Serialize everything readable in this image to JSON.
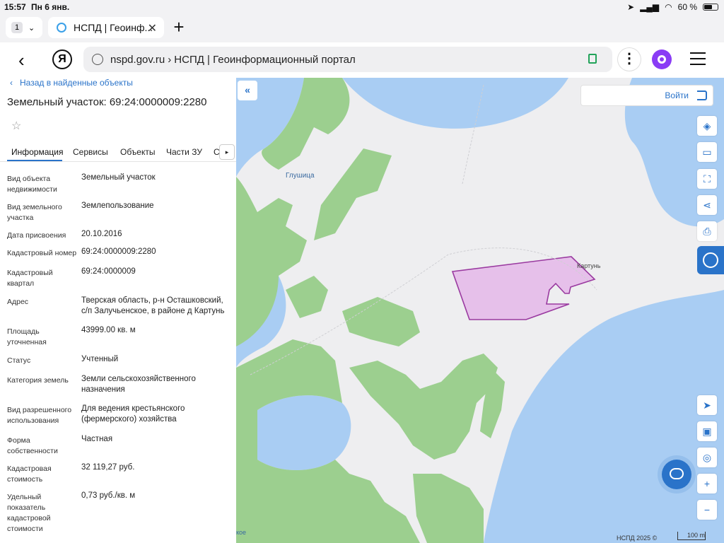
{
  "status_bar": {
    "time": "15:57",
    "date": "Пн 6 янв.",
    "battery": "60 %",
    "battery_level": 0.6
  },
  "browser": {
    "tab_count": "1",
    "tab_title": "НСПД | Геоинф...",
    "url_domain": "nspd.gov.ru",
    "url_separator": "›",
    "page_title": "НСПД | Геоинформационный портал"
  },
  "panel": {
    "back_link": "Назад в найденные объекты",
    "title": "Земельный участок: 69:24:0000009:2280",
    "tabs": [
      "Информация",
      "Сервисы",
      "Объекты",
      "Части ЗУ",
      "С"
    ],
    "rows": [
      {
        "key": "Вид объекта недвижимости",
        "value": "Земельный участок"
      },
      {
        "key": "Вид земельного участка",
        "value": "Землепользование"
      },
      {
        "key": "Дата присвоения",
        "value": "20.10.2016"
      },
      {
        "key": "Кадастровый номер",
        "value": "69:24:0000009:2280"
      },
      {
        "key": "Кадастровый квартал",
        "value": "69:24:0000009"
      },
      {
        "key": "Адрес",
        "value": "Тверская область, р-н Осташковский, с/п Залучьенское, в районе д Картунь"
      },
      {
        "key": "Площадь уточненная",
        "value": "43999.00 кв. м"
      },
      {
        "key": "Статус",
        "value": "Учтенный"
      },
      {
        "key": "Категория земель",
        "value": "Земли сельскохозяйственного назначения"
      },
      {
        "key": "Вид разрешенного использования",
        "value": "Для ведения крестьянского (фермерского) хозяйства"
      },
      {
        "key": "Форма собственности",
        "value": "Частная"
      },
      {
        "key": "Кадастровая стоимость",
        "value": "32 119,27 руб."
      },
      {
        "key": "Удельный показатель кадастровой стоимости",
        "value": "0,73 руб./кв. м"
      }
    ]
  },
  "map": {
    "login_label": "Войти",
    "labels": {
      "lake": "Глушица",
      "village": "Картунь",
      "bottom": "кое"
    },
    "copyright": "НСПД 2025 ©",
    "scale": "100 m",
    "colors": {
      "water": "#a9cdf3",
      "forest": "#9ccf8f",
      "parcel_fill": "#e4b4e8",
      "parcel_stroke": "#9a3aa0",
      "accent": "#2a73c9"
    }
  }
}
